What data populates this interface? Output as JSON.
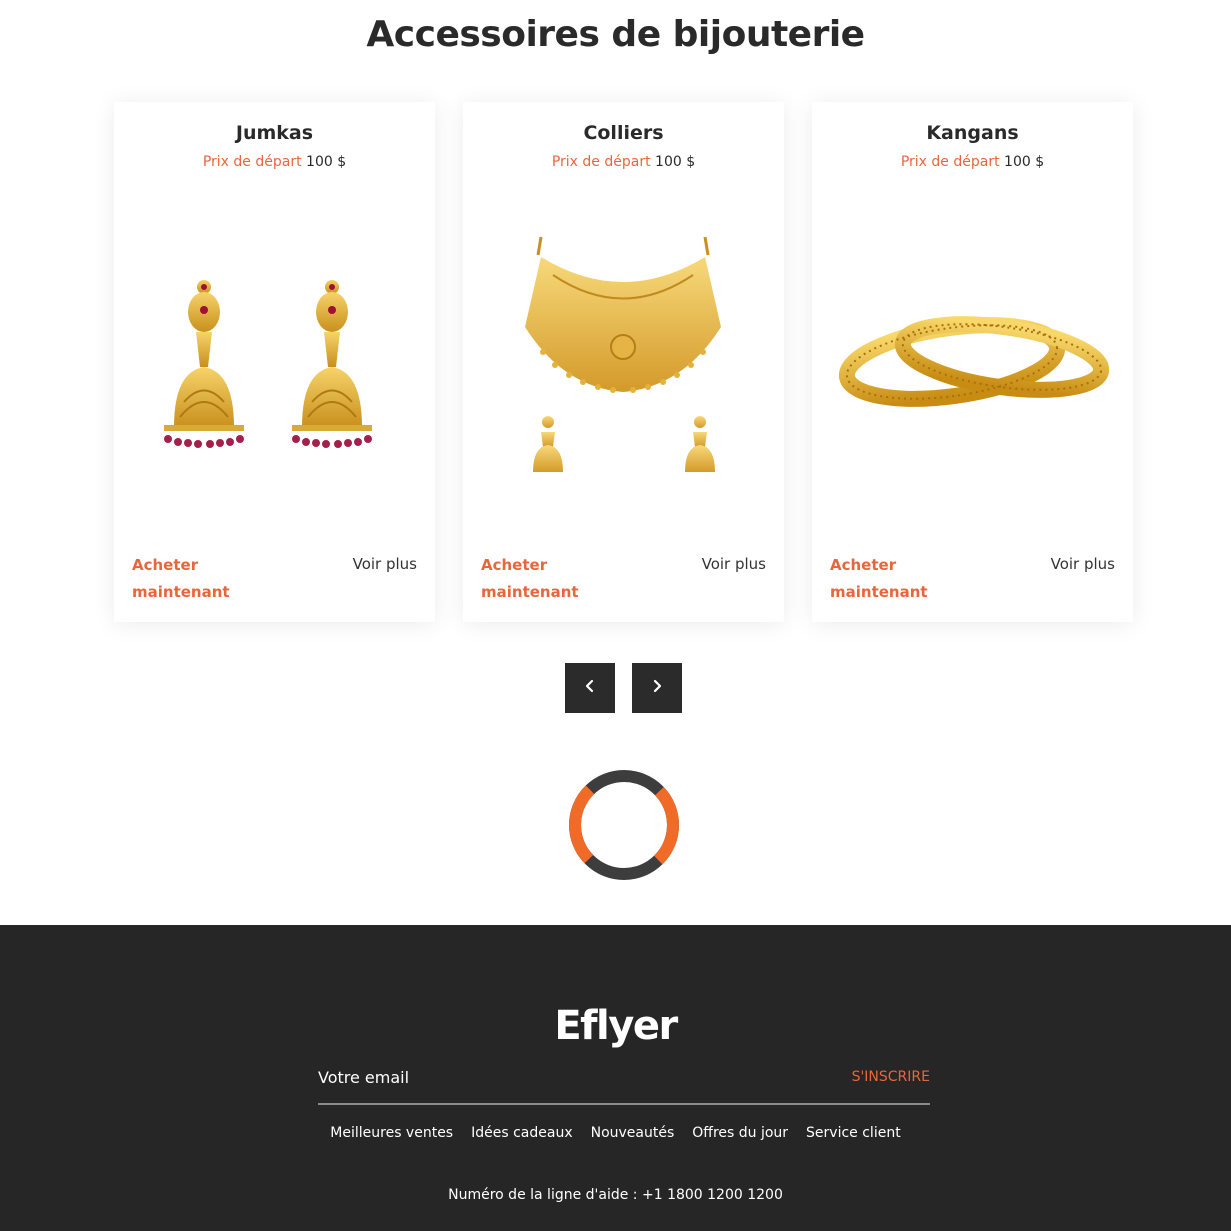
{
  "section": {
    "title": "Accessoires de bijouterie"
  },
  "products": [
    {
      "name": "Jumkas",
      "price_label": "Prix de départ",
      "price": "100 $",
      "image": "jhumka-earrings-image",
      "buy_label": "Acheter maintenant",
      "more_label": "Voir plus"
    },
    {
      "name": "Colliers",
      "price_label": "Prix de départ",
      "price": "100 $",
      "image": "necklace-set-image",
      "buy_label": "Acheter maintenant",
      "more_label": "Voir plus"
    },
    {
      "name": "Kangans",
      "price_label": "Prix de départ",
      "price": "100 $",
      "image": "bangles-image",
      "buy_label": "Acheter maintenant",
      "more_label": "Voir plus"
    }
  ],
  "carousel": {
    "prev_icon": "chevron-left-icon",
    "next_icon": "chevron-right-icon"
  },
  "loader": {
    "icon": "loading-spinner-icon"
  },
  "footer": {
    "brand": "Eflyer",
    "email_placeholder": "Votre email",
    "subscribe_label": "S'INSCRIRE",
    "links": [
      "Meilleures ventes",
      "Idées cadeaux",
      "Nouveautés",
      "Offres du jour",
      "Service client"
    ],
    "helpline": "Numéro de la ligne d'aide : +1 1800 1200 1200"
  },
  "colors": {
    "accent": "#e8663c",
    "dark": "#262626",
    "gold": "#e3b23c",
    "text": "#2a2a2a"
  }
}
